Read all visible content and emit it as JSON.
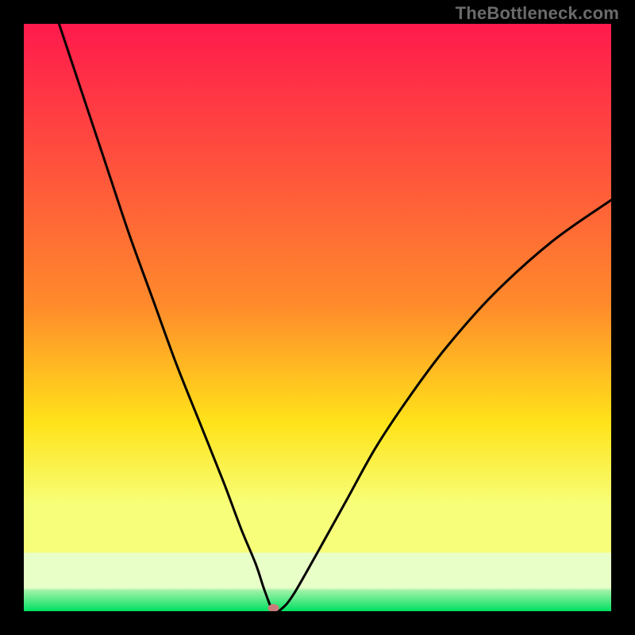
{
  "watermark": "TheBottleneck.com",
  "chart_data": {
    "type": "line",
    "title": "",
    "xlabel": "",
    "ylabel": "",
    "xlim": [
      0,
      100
    ],
    "ylim": [
      0,
      100
    ],
    "grid": false,
    "legend": false,
    "background_gradient": {
      "top": "#ff1a4d",
      "mid1": "#ff8b2b",
      "mid2": "#ffe31a",
      "lower": "#f7ff7a",
      "band_pale": "#e8ffc8",
      "bottom_green": "#00e060"
    },
    "minimum_marker": {
      "x": 42.5,
      "y": 0,
      "color": "#c97b7b"
    },
    "series": [
      {
        "name": "curve",
        "x": [
          6,
          10,
          14,
          18,
          22,
          26,
          30,
          34,
          37,
          39.5,
          41,
          42.5,
          44,
          46,
          50,
          55,
          60,
          66,
          72,
          80,
          90,
          100
        ],
        "y": [
          100,
          88,
          76,
          64,
          53,
          42,
          32,
          22,
          14,
          8,
          3.5,
          0,
          0.5,
          3,
          10,
          19,
          28,
          37,
          45,
          54,
          63,
          70
        ],
        "color": "#000000",
        "stroke_width": 3
      }
    ]
  }
}
